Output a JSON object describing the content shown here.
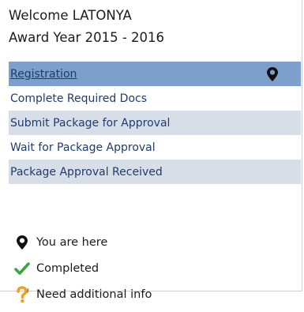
{
  "header": {
    "welcome": "Welcome LATONYA",
    "award_year": "Award Year 2015 - 2016"
  },
  "steps": [
    {
      "label": "Registration",
      "state": "current",
      "link": true
    },
    {
      "label": "Complete Required Docs",
      "state": "pending"
    },
    {
      "label": "Submit Package for Approval",
      "state": "pending"
    },
    {
      "label": "Wait for Package Approval",
      "state": "pending"
    },
    {
      "label": "Package Approval Received",
      "state": "pending"
    }
  ],
  "legend": {
    "you_are_here": "You are here",
    "completed": "Completed",
    "need_info": "Need additional info"
  },
  "icons": {
    "current_marker": "location-pin-icon",
    "completed_marker": "checkmark-icon",
    "info_marker": "question-mark-icon"
  },
  "colors": {
    "current_row": "#7c9fcc",
    "alternate_row": "#d8dee8",
    "link_text": "#1f3b70",
    "check": "#3aa53f",
    "question": "#f0a21a"
  }
}
